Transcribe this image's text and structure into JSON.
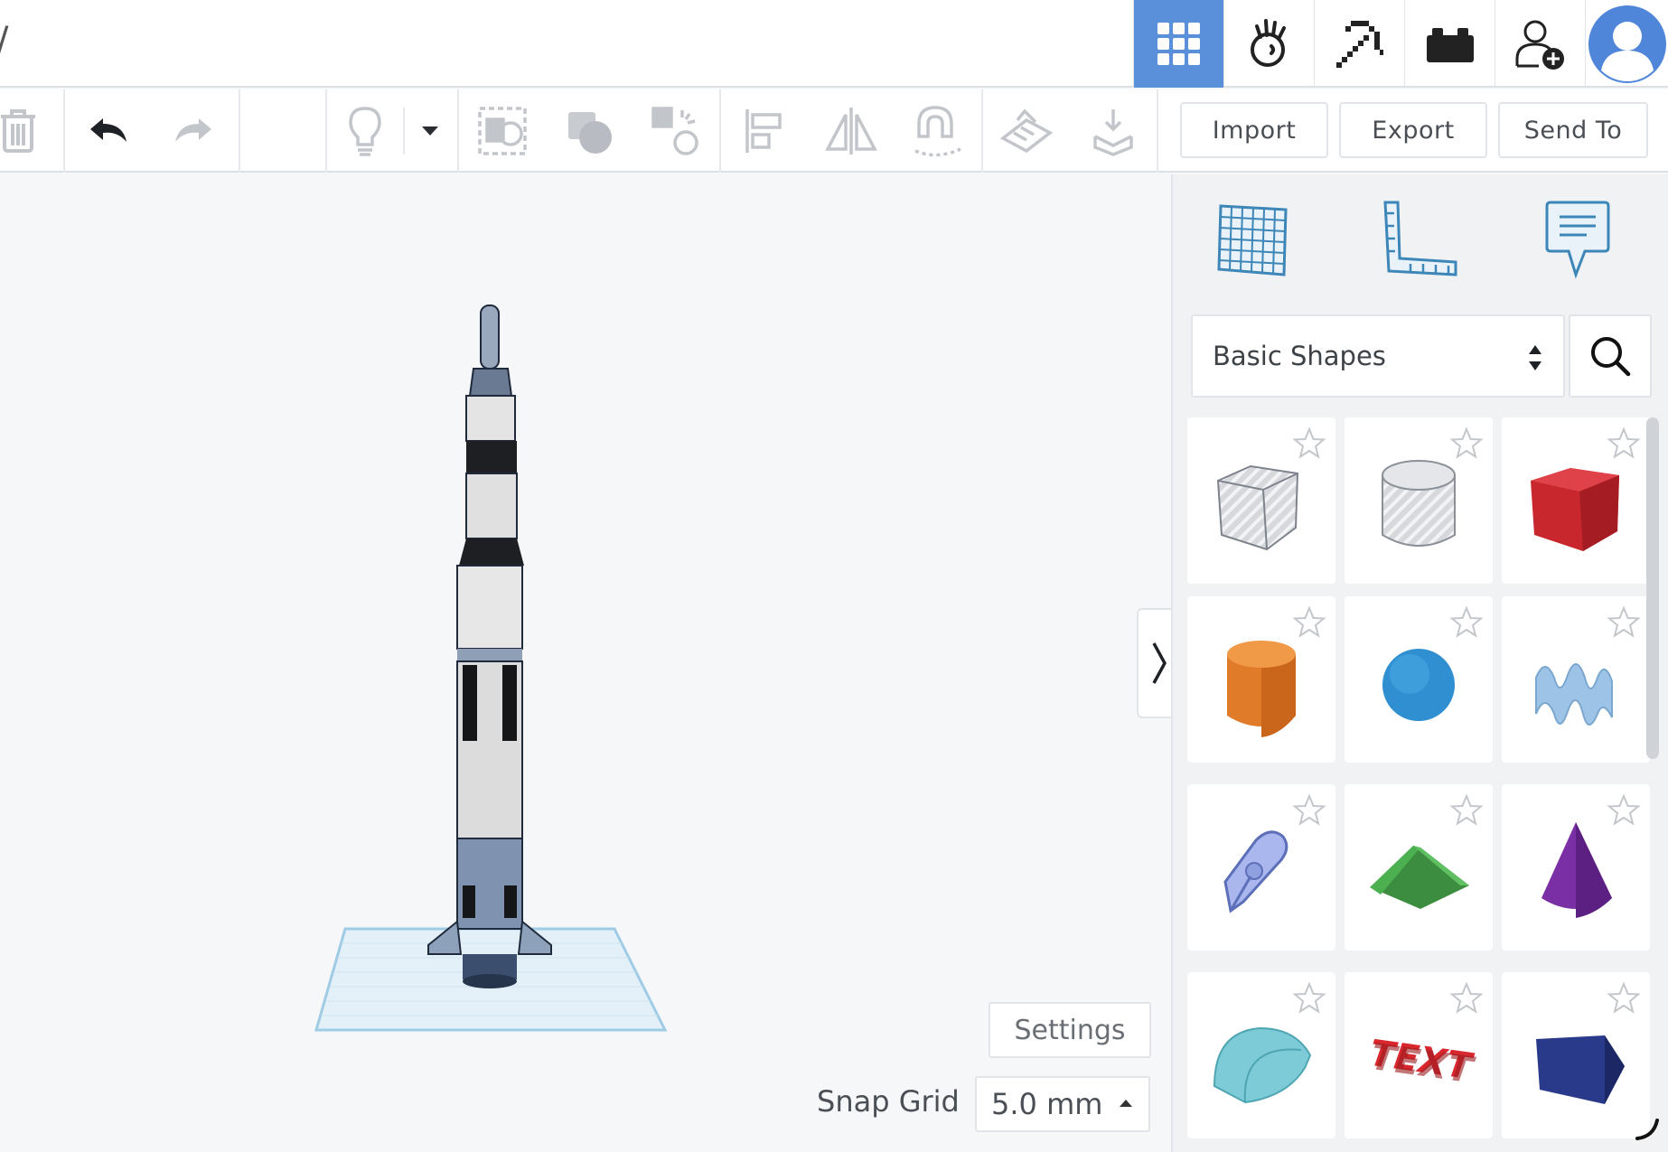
{
  "header": {
    "title_fragment": "/",
    "nav": [
      {
        "icon": "grid-view-icon",
        "active": true
      },
      {
        "icon": "tinker-hand-icon",
        "active": false
      },
      {
        "icon": "pickaxe-icon",
        "active": false
      },
      {
        "icon": "bricks-icon",
        "active": false
      },
      {
        "icon": "add-user-icon",
        "active": false
      },
      {
        "icon": "user-avatar-icon",
        "active": false
      }
    ],
    "active_color": "#5a90da"
  },
  "toolbar": {
    "import_label": "Import",
    "export_label": "Export",
    "send_to_label": "Send To"
  },
  "viewport": {
    "settings_label": "Settings",
    "snap_grid_label": "Snap Grid",
    "snap_grid_value": "5.0 mm"
  },
  "panel": {
    "library_selected": "Basic Shapes",
    "tools": [
      "workplane-icon",
      "ruler-icon",
      "notes-icon"
    ],
    "shapes": [
      {
        "name": "box-hole",
        "icon": "box-hole-icon"
      },
      {
        "name": "cylinder-hole",
        "icon": "cylinder-hole-icon"
      },
      {
        "name": "box",
        "icon": "box-icon",
        "color": "#c8282d"
      },
      {
        "name": "cylinder",
        "icon": "cylinder-icon",
        "color": "#e07b2a"
      },
      {
        "name": "sphere",
        "icon": "sphere-icon",
        "color": "#2f8fd0"
      },
      {
        "name": "scribble",
        "icon": "scribble-icon",
        "color": "#9dc3e6"
      },
      {
        "name": "shape-generator",
        "icon": "pen-icon",
        "color": "#aab6ee"
      },
      {
        "name": "roof",
        "icon": "roof-icon",
        "color": "#4caf50"
      },
      {
        "name": "cone",
        "icon": "cone-icon",
        "color": "#7b2fa5"
      },
      {
        "name": "round-roof",
        "icon": "round-roof-icon",
        "color": "#7dcbd6"
      },
      {
        "name": "text",
        "icon": "text-shape-icon",
        "color": "#d8282d"
      },
      {
        "name": "wedge",
        "icon": "wedge-icon",
        "color": "#2a3a8a"
      }
    ]
  }
}
